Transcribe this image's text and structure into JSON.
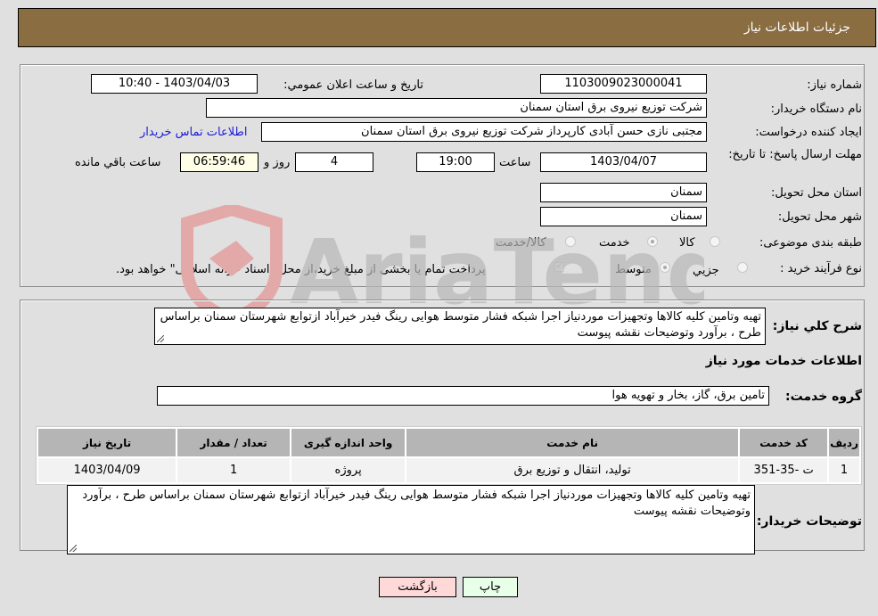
{
  "header": {
    "title": "جزئیات اطلاعات نیاز"
  },
  "form": {
    "need_number": {
      "label": "شماره نیاز:",
      "value": "1103009023000041"
    },
    "announce_datetime": {
      "label": "تاریخ و ساعت اعلان عمومي:",
      "value": "1403/04/03 - 10:40"
    },
    "buyer_org": {
      "label": "نام دستگاه خریدار:",
      "value": "شرکت توزیع نیروی برق استان سمنان"
    },
    "requester": {
      "label": "ایجاد کننده درخواست:",
      "value": "مجتبی نازی حسن آبادی کارپرداز شرکت توزیع نیروی برق استان سمنان"
    },
    "buyer_contact_link": "اطلاعات تماس خریدار",
    "deadline": {
      "label": "مهلت ارسال پاسخ: تا تاریخ:",
      "date": "1403/04/07",
      "time_label": "ساعت",
      "time": "19:00",
      "days": "4",
      "days_label": "روز و",
      "remaining": "06:59:46",
      "remaining_label": "ساعت باقي مانده"
    },
    "delivery_province": {
      "label": "استان محل تحویل:",
      "value": "سمنان"
    },
    "delivery_city": {
      "label": "شهر محل تحویل:",
      "value": "سمنان"
    },
    "category": {
      "label": "طبقه بندی موضوعی:",
      "options": [
        "کالا",
        "خدمت",
        "کالا/خدمت"
      ],
      "selected": "خدمت"
    },
    "purchase_type": {
      "label": "نوع فرآیند خرید :",
      "options": [
        "جزيي",
        "متوسط"
      ],
      "selected": "متوسط",
      "treasury_note": "پرداخت تمام یا بخشی از مبلغ خرید،از محل \"اسناد خزانه اسلامی\" خواهد بود.",
      "treasury_checked": true
    }
  },
  "description": {
    "label": "شرح کلي نیاز:",
    "value": "تهیه وتامین کلیه کالاها وتجهیزات موردنیاز اجرا شبکه فشار متوسط هوایی رینگ فیدر خیرآباد ازتوابع شهرستان سمنان براساس طرح ، برآورد وتوضیحات نقشه پیوست"
  },
  "services_section": {
    "title": "اطلاعات خدمات مورد نیاز",
    "group_label": "گروه خدمت:",
    "group_value": "تامین برق، گاز، بخار و تهویه هوا"
  },
  "table": {
    "headers": [
      "ردیف",
      "کد خدمت",
      "نام خدمت",
      "واحد اندازه گیری",
      "تعداد / مقدار",
      "تاریخ نیاز"
    ],
    "rows": [
      [
        "1",
        "ت -35-351",
        "تولید، انتقال و توزیع برق",
        "پروژه",
        "1",
        "1403/04/09"
      ]
    ]
  },
  "buyer_notes": {
    "label": "توضیحات خریدار:",
    "value": "تهیه وتامین کلیه کالاها وتجهیزات موردنیاز اجرا شبکه فشار متوسط هوایی رینگ فیدر خیرآباد ازتوابع شهرستان سمنان براساس طرح ، برآورد وتوضیحات نقشه پیوست"
  },
  "buttons": {
    "print": "چاپ",
    "back": "بازگشت"
  },
  "watermark": {
    "text": "AriaTender.neT"
  },
  "colors": {
    "header_bg": "#8b6d42",
    "link": "#1a1adb",
    "back_btn": "#ffd8d8",
    "print_btn": "#e8ffe8"
  }
}
